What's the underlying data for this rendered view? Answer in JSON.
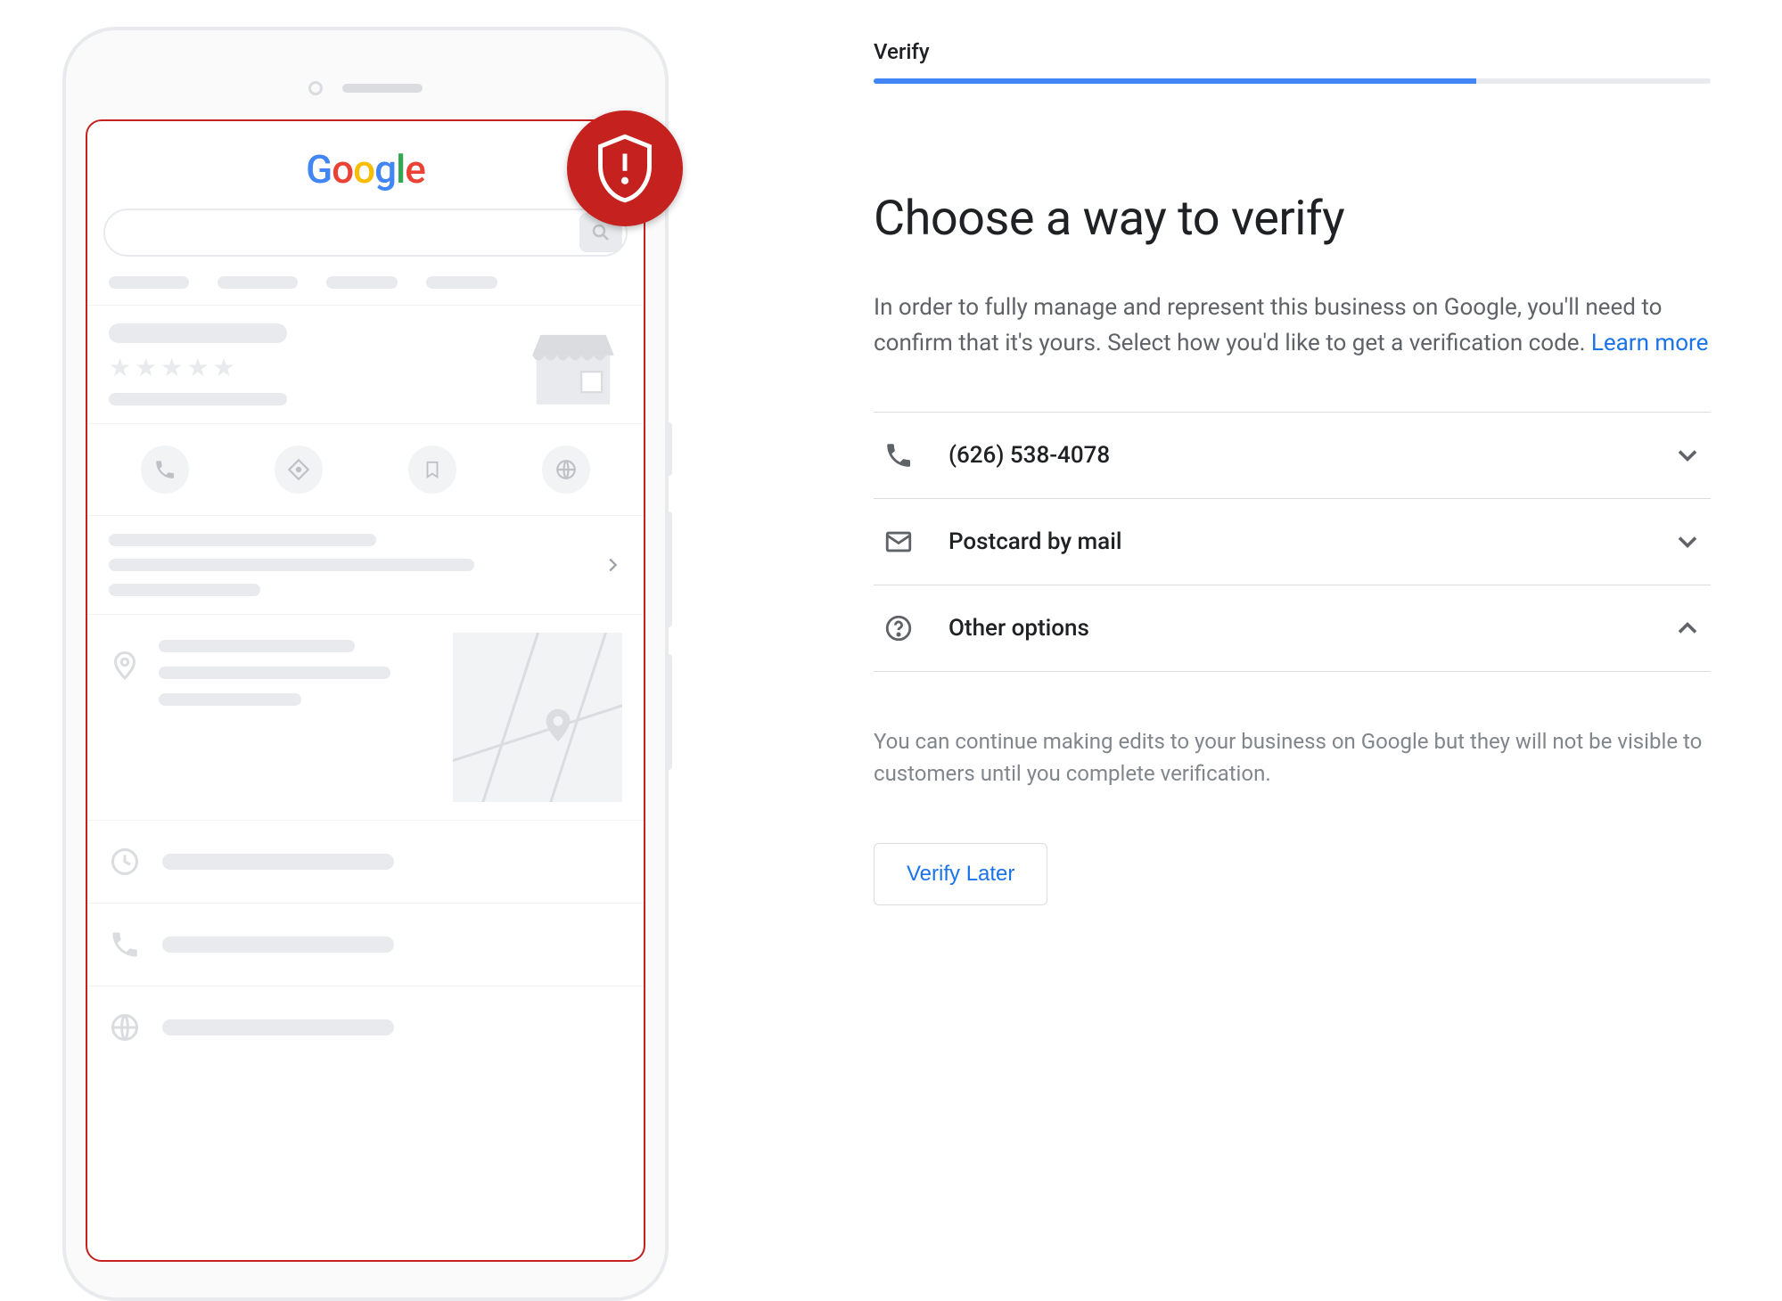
{
  "progress": {
    "label": "Verify",
    "percent": 72
  },
  "heading": "Choose a way to verify",
  "description_prefix": "In order to fully manage and represent this business on Google, you'll need to confirm that it's yours. Select how you'd like to get a verification code. ",
  "learn_more": "Learn more",
  "options": {
    "phone": {
      "label": "(626) 538-4078"
    },
    "postcard": {
      "label": "Postcard by mail"
    },
    "other": {
      "label": "Other options"
    }
  },
  "subtext": "You can continue making edits to your business on Google but they will not be visible to customers until you complete verification.",
  "verify_later": "Verify Later",
  "mockup": {
    "logo": "Google"
  }
}
